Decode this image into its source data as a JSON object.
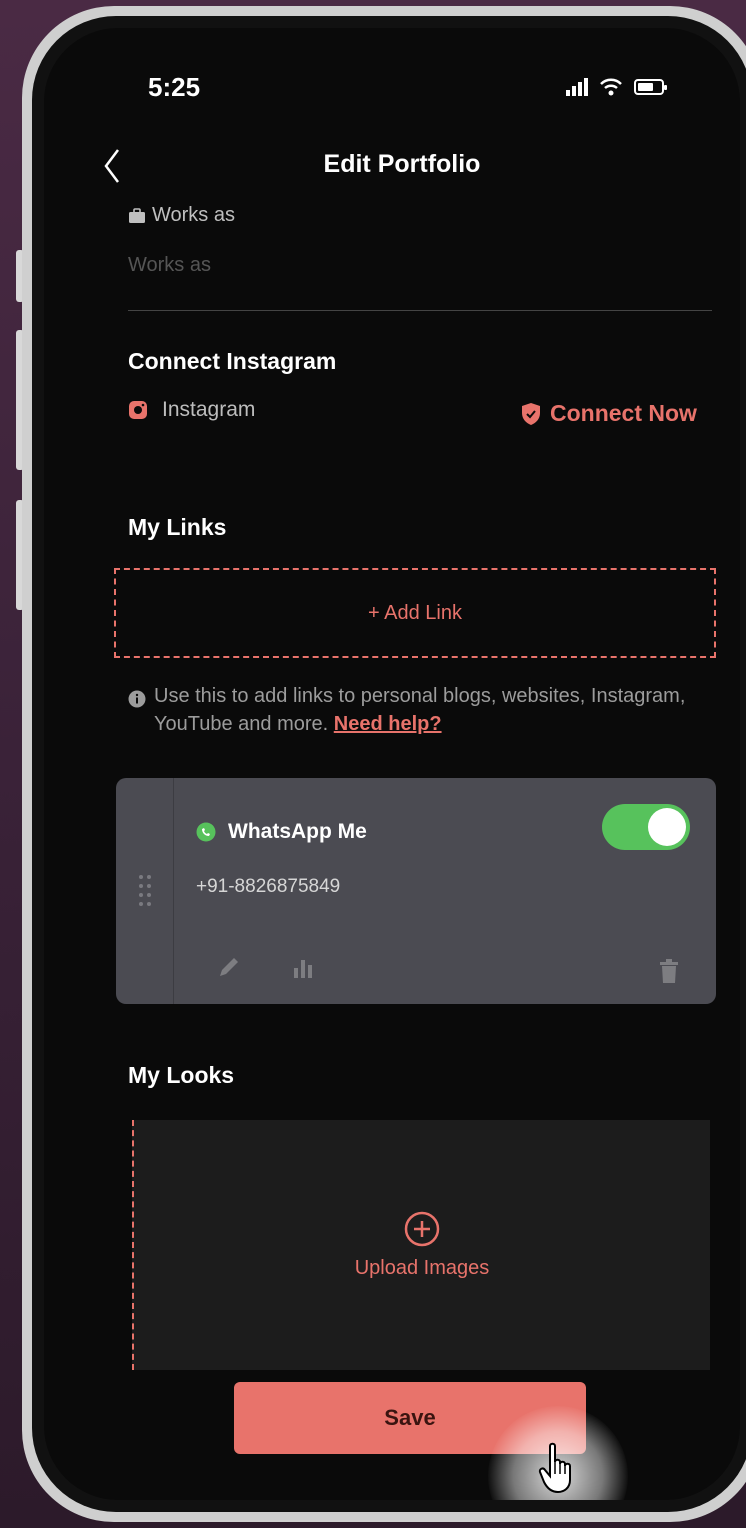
{
  "status": {
    "time": "5:25"
  },
  "header": {
    "title": "Edit Portfolio"
  },
  "works_as": {
    "label": "Works as",
    "placeholder": "Works as"
  },
  "instagram": {
    "section_title": "Connect Instagram",
    "label": "Instagram",
    "connect_label": "Connect Now"
  },
  "links": {
    "section_title": "My Links",
    "add_label": "+ Add Link",
    "hint_text": "Use this to add links to personal blogs, websites, Instagram, YouTube and more.",
    "help_link": "Need help?",
    "items": [
      {
        "title": "WhatsApp Me",
        "value": "+91-8826875849",
        "enabled": true
      }
    ]
  },
  "looks": {
    "section_title": "My Looks",
    "upload_label": "Upload Images"
  },
  "footer": {
    "save_label": "Save"
  },
  "colors": {
    "accent": "#e8736b",
    "toggle_on": "#57c25c",
    "background": "#0a0a0a",
    "card": "#4b4b52"
  }
}
